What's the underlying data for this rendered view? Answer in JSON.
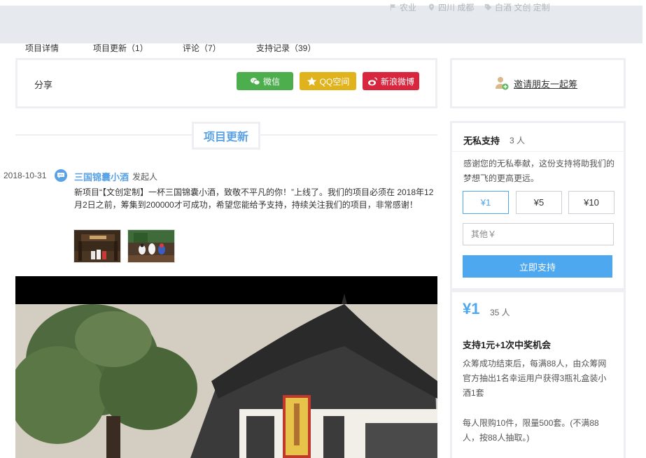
{
  "header": {
    "category": "农业",
    "location": "四川 成都",
    "tags": "白酒 文创 定制"
  },
  "tabs": [
    {
      "label": "项目详情"
    },
    {
      "label": "项目更新（1）"
    },
    {
      "label": "评论（7）"
    },
    {
      "label": "支持记录（39）"
    }
  ],
  "share": {
    "label": "分享",
    "wechat": "微信",
    "qq": "QQ空间",
    "weibo": "新浪微博",
    "colors": {
      "wechat": "#4cae4c",
      "qq": "#e0b21c",
      "weibo": "#d9263f"
    }
  },
  "invite": {
    "label": "邀请朋友一起筹"
  },
  "updates": {
    "section_title": "项目更新",
    "items": [
      {
        "date": "2018-10-31",
        "author": "三国锦囊小酒",
        "role": "发起人",
        "body": "新项目“【文创定制】一杯三国锦囊小酒，致敬不平凡的你！”上线了。我们的项目必须在 2018年12月2日之前，筹集到200000才可成功，希望您能给予支持，持续关注我们的项目，非常感谢！"
      }
    ]
  },
  "support": {
    "title": "无私支持",
    "count": "3 人",
    "desc": "感谢您的无私奉献，这份支持将助我们的梦想飞的更高更远。",
    "amounts": [
      "¥1",
      "¥5",
      "¥10"
    ],
    "other_placeholder": "其他￥",
    "button": "立即支持"
  },
  "tier": {
    "price": "¥1",
    "count": "35 人",
    "title": "支持1元+1次中奖机会",
    "desc": "众筹成功结束后，每满88人，由众筹网官方抽出1名幸运用户获得3瓶礼盒装小酒1套",
    "limit": "每人限购10件，限量500套。(不满88人，按88人抽取。)"
  },
  "accent_color": "#4ea8f0"
}
